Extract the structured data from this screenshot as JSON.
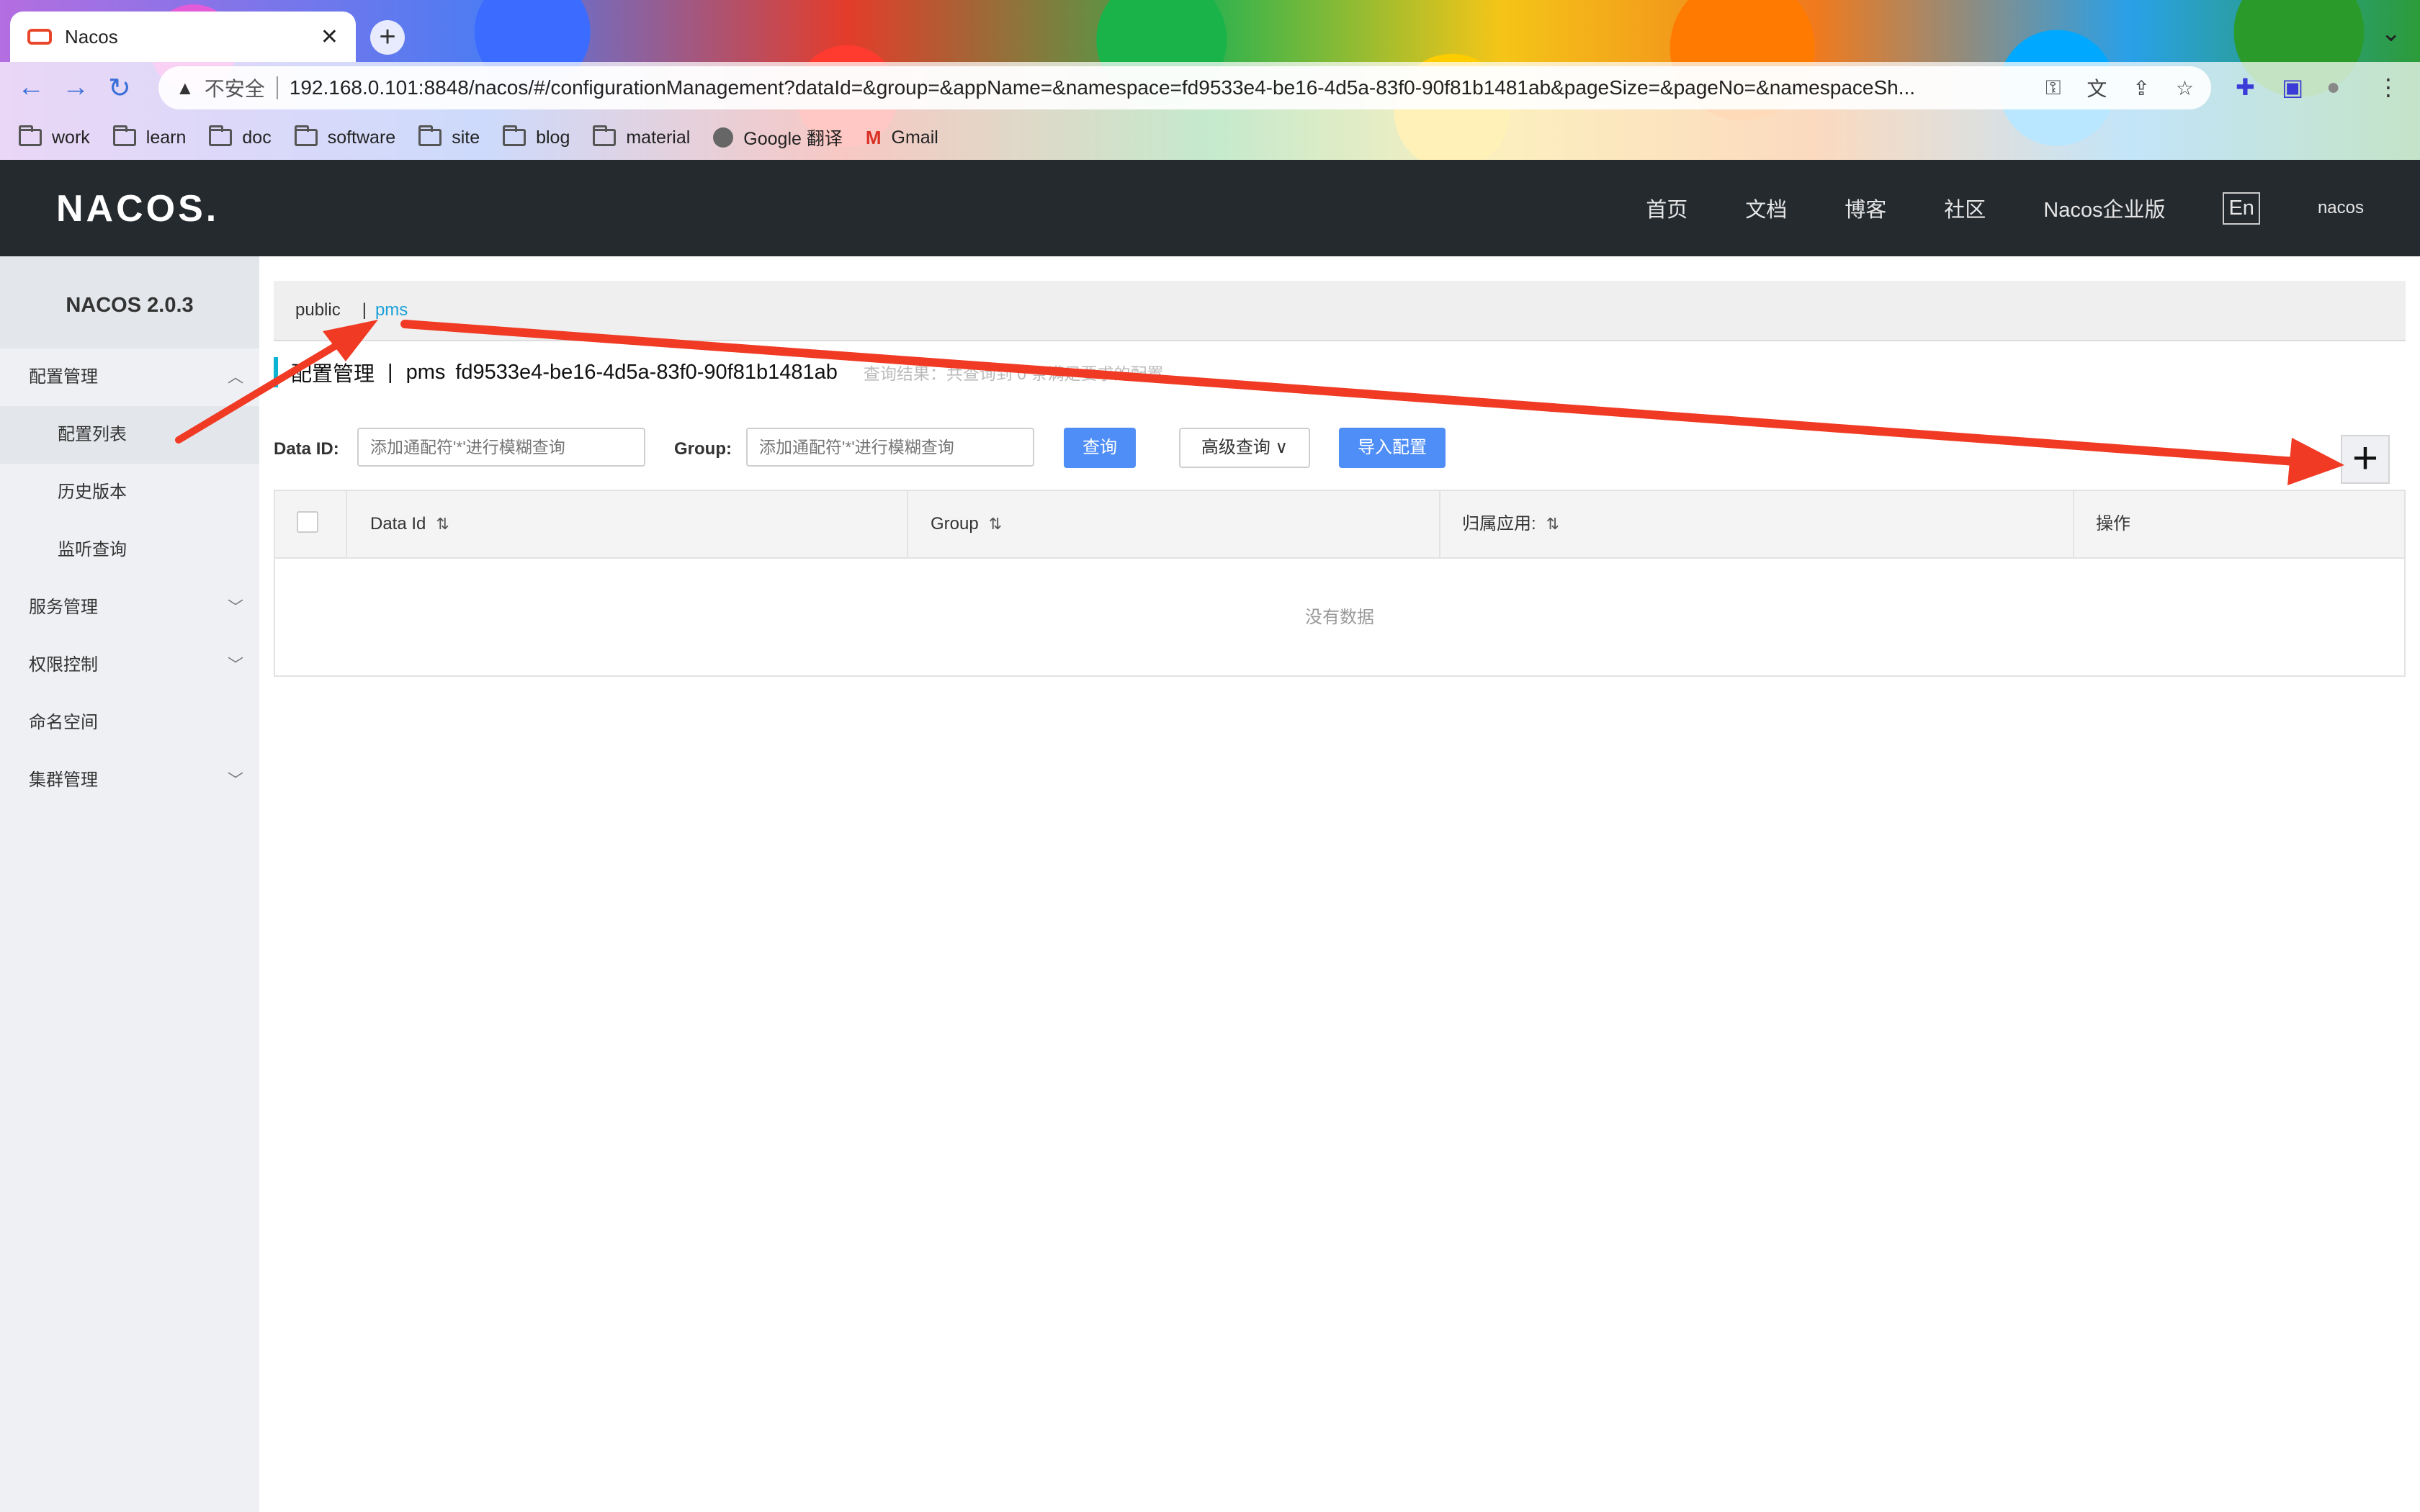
{
  "browser": {
    "tab_title": "Nacos",
    "tab_close": "✕",
    "new_tab": "+",
    "insecure_label": "不安全",
    "url": "192.168.0.101:8848/nacos/#/configurationManagement?dataId=&group=&appName=&namespace=fd9533e4-be16-4d5a-83f0-90f81b1481ab&pageSize=&pageNo=&namespaceSh...",
    "bookmarks": [
      "work",
      "learn",
      "doc",
      "software",
      "site",
      "blog",
      "material",
      "Google 翻译",
      "Gmail"
    ]
  },
  "header": {
    "logo": "NACOS.",
    "nav": [
      "首页",
      "文档",
      "博客",
      "社区",
      "Nacos企业版"
    ],
    "lang": "En",
    "user": "nacos"
  },
  "sidebar": {
    "version": "NACOS 2.0.3",
    "items": [
      {
        "label": "配置管理",
        "expanded": true
      },
      {
        "label": "配置列表",
        "sub": true,
        "active": true
      },
      {
        "label": "历史版本",
        "sub": true
      },
      {
        "label": "监听查询",
        "sub": true
      },
      {
        "label": "服务管理"
      },
      {
        "label": "权限控制"
      },
      {
        "label": "命名空间"
      },
      {
        "label": "集群管理"
      }
    ]
  },
  "namespaces": {
    "items": [
      "public",
      "pms"
    ],
    "active": "pms",
    "separator": "|"
  },
  "page": {
    "title": "配置管理",
    "separator": "|",
    "namespace_name": "pms",
    "namespace_id": "fd9533e4-be16-4d5a-83f0-90f81b1481ab",
    "result_info": "查询结果：共查询到 0 条满足要求的配置。"
  },
  "search": {
    "data_id_label": "Data ID:",
    "data_id_placeholder": "添加通配符'*'进行模糊查询",
    "group_label": "Group:",
    "group_placeholder": "添加通配符'*'进行模糊查询",
    "query_button": "查询",
    "advanced_button": "高级查询",
    "import_button": "导入配置",
    "add_button": "+"
  },
  "table": {
    "columns": [
      "Data Id",
      "Group",
      "归属应用:",
      "操作"
    ],
    "empty_text": "没有数据"
  },
  "colors": {
    "header_bg": "#252a2f",
    "accent_blue": "#4f8ef7",
    "annotation_red": "#f03a24",
    "active_link": "#1ba0d8"
  }
}
